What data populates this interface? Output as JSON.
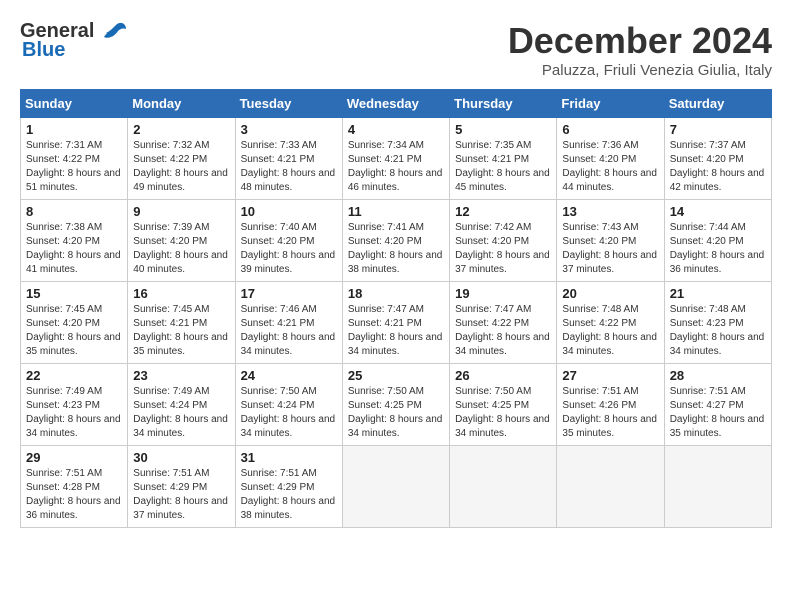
{
  "header": {
    "logo_line1": "General",
    "logo_line2": "Blue",
    "month_title": "December 2024",
    "subtitle": "Paluzza, Friuli Venezia Giulia, Italy"
  },
  "weekdays": [
    "Sunday",
    "Monday",
    "Tuesday",
    "Wednesday",
    "Thursday",
    "Friday",
    "Saturday"
  ],
  "weeks": [
    [
      {
        "day": 1,
        "sunrise": "7:31 AM",
        "sunset": "4:22 PM",
        "daylight": "8 hours and 51 minutes."
      },
      {
        "day": 2,
        "sunrise": "7:32 AM",
        "sunset": "4:22 PM",
        "daylight": "8 hours and 49 minutes."
      },
      {
        "day": 3,
        "sunrise": "7:33 AM",
        "sunset": "4:21 PM",
        "daylight": "8 hours and 48 minutes."
      },
      {
        "day": 4,
        "sunrise": "7:34 AM",
        "sunset": "4:21 PM",
        "daylight": "8 hours and 46 minutes."
      },
      {
        "day": 5,
        "sunrise": "7:35 AM",
        "sunset": "4:21 PM",
        "daylight": "8 hours and 45 minutes."
      },
      {
        "day": 6,
        "sunrise": "7:36 AM",
        "sunset": "4:20 PM",
        "daylight": "8 hours and 44 minutes."
      },
      {
        "day": 7,
        "sunrise": "7:37 AM",
        "sunset": "4:20 PM",
        "daylight": "8 hours and 42 minutes."
      }
    ],
    [
      {
        "day": 8,
        "sunrise": "7:38 AM",
        "sunset": "4:20 PM",
        "daylight": "8 hours and 41 minutes."
      },
      {
        "day": 9,
        "sunrise": "7:39 AM",
        "sunset": "4:20 PM",
        "daylight": "8 hours and 40 minutes."
      },
      {
        "day": 10,
        "sunrise": "7:40 AM",
        "sunset": "4:20 PM",
        "daylight": "8 hours and 39 minutes."
      },
      {
        "day": 11,
        "sunrise": "7:41 AM",
        "sunset": "4:20 PM",
        "daylight": "8 hours and 38 minutes."
      },
      {
        "day": 12,
        "sunrise": "7:42 AM",
        "sunset": "4:20 PM",
        "daylight": "8 hours and 37 minutes."
      },
      {
        "day": 13,
        "sunrise": "7:43 AM",
        "sunset": "4:20 PM",
        "daylight": "8 hours and 37 minutes."
      },
      {
        "day": 14,
        "sunrise": "7:44 AM",
        "sunset": "4:20 PM",
        "daylight": "8 hours and 36 minutes."
      }
    ],
    [
      {
        "day": 15,
        "sunrise": "7:45 AM",
        "sunset": "4:20 PM",
        "daylight": "8 hours and 35 minutes."
      },
      {
        "day": 16,
        "sunrise": "7:45 AM",
        "sunset": "4:21 PM",
        "daylight": "8 hours and 35 minutes."
      },
      {
        "day": 17,
        "sunrise": "7:46 AM",
        "sunset": "4:21 PM",
        "daylight": "8 hours and 34 minutes."
      },
      {
        "day": 18,
        "sunrise": "7:47 AM",
        "sunset": "4:21 PM",
        "daylight": "8 hours and 34 minutes."
      },
      {
        "day": 19,
        "sunrise": "7:47 AM",
        "sunset": "4:22 PM",
        "daylight": "8 hours and 34 minutes."
      },
      {
        "day": 20,
        "sunrise": "7:48 AM",
        "sunset": "4:22 PM",
        "daylight": "8 hours and 34 minutes."
      },
      {
        "day": 21,
        "sunrise": "7:48 AM",
        "sunset": "4:23 PM",
        "daylight": "8 hours and 34 minutes."
      }
    ],
    [
      {
        "day": 22,
        "sunrise": "7:49 AM",
        "sunset": "4:23 PM",
        "daylight": "8 hours and 34 minutes."
      },
      {
        "day": 23,
        "sunrise": "7:49 AM",
        "sunset": "4:24 PM",
        "daylight": "8 hours and 34 minutes."
      },
      {
        "day": 24,
        "sunrise": "7:50 AM",
        "sunset": "4:24 PM",
        "daylight": "8 hours and 34 minutes."
      },
      {
        "day": 25,
        "sunrise": "7:50 AM",
        "sunset": "4:25 PM",
        "daylight": "8 hours and 34 minutes."
      },
      {
        "day": 26,
        "sunrise": "7:50 AM",
        "sunset": "4:25 PM",
        "daylight": "8 hours and 34 minutes."
      },
      {
        "day": 27,
        "sunrise": "7:51 AM",
        "sunset": "4:26 PM",
        "daylight": "8 hours and 35 minutes."
      },
      {
        "day": 28,
        "sunrise": "7:51 AM",
        "sunset": "4:27 PM",
        "daylight": "8 hours and 35 minutes."
      }
    ],
    [
      {
        "day": 29,
        "sunrise": "7:51 AM",
        "sunset": "4:28 PM",
        "daylight": "8 hours and 36 minutes."
      },
      {
        "day": 30,
        "sunrise": "7:51 AM",
        "sunset": "4:29 PM",
        "daylight": "8 hours and 37 minutes."
      },
      {
        "day": 31,
        "sunrise": "7:51 AM",
        "sunset": "4:29 PM",
        "daylight": "8 hours and 38 minutes."
      },
      null,
      null,
      null,
      null
    ]
  ]
}
